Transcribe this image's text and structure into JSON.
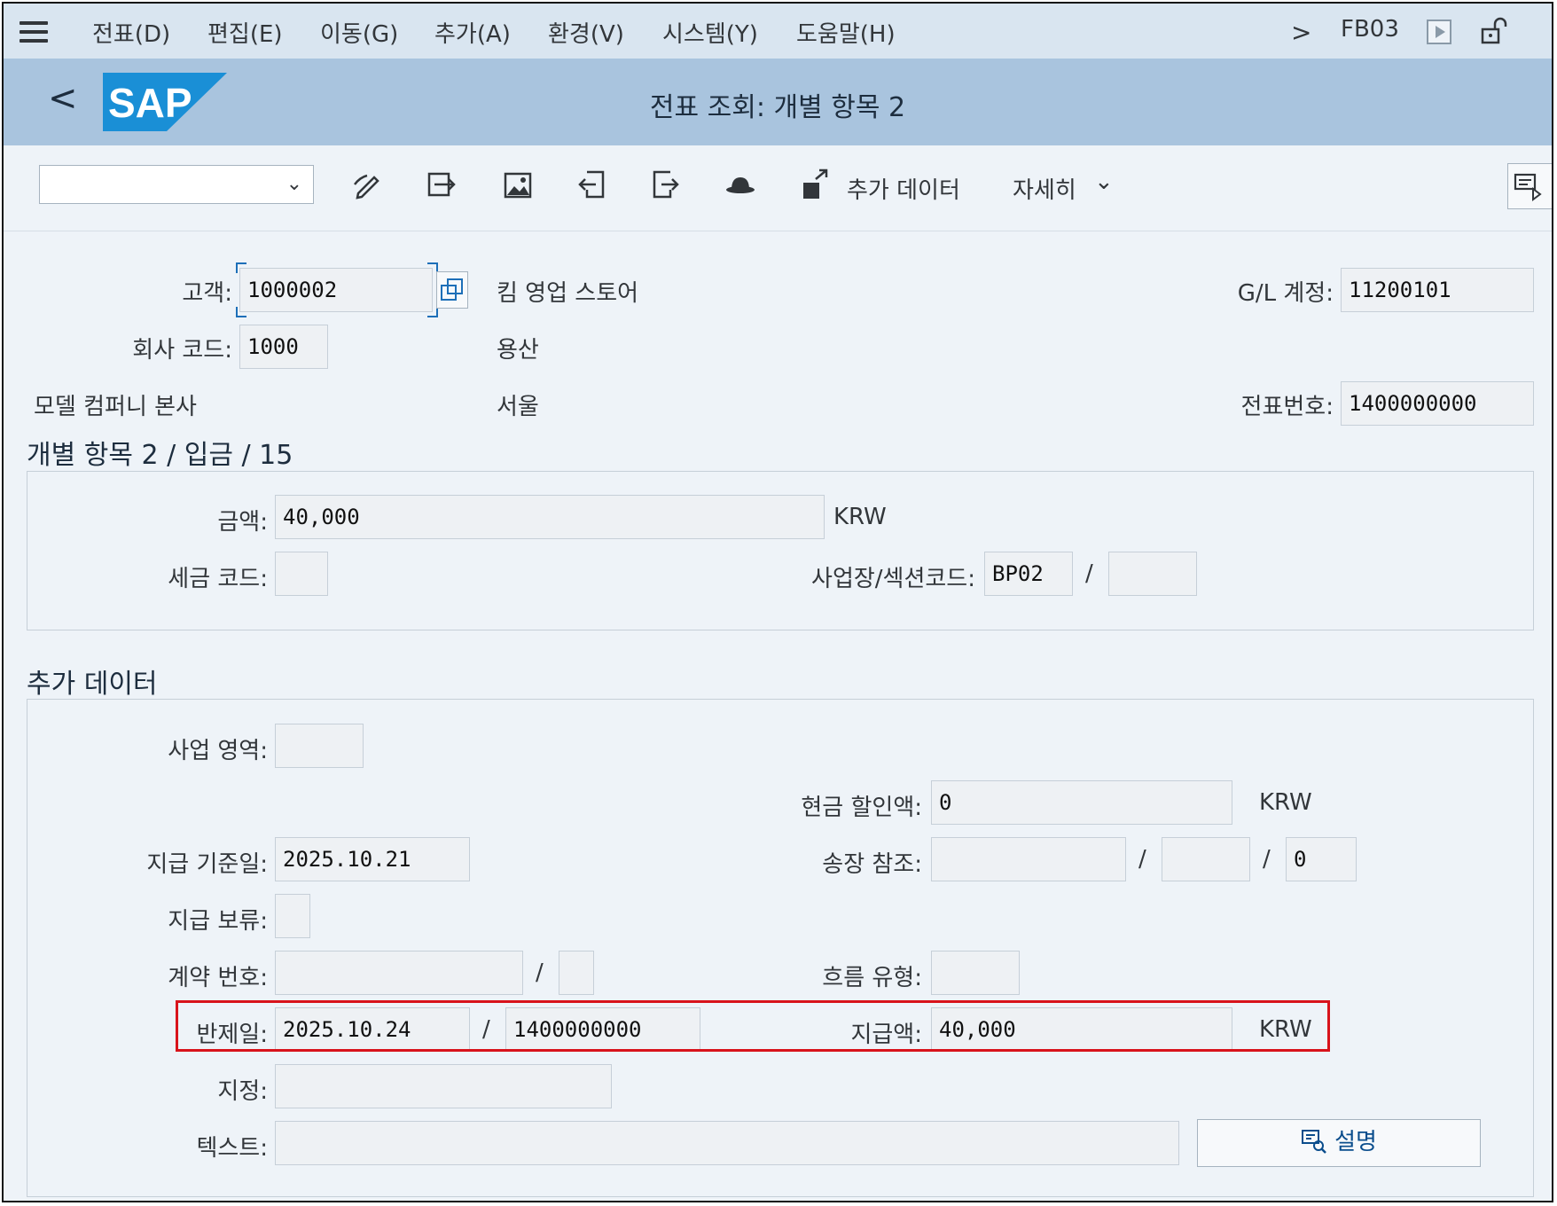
{
  "menu": {
    "items": [
      "전표(D)",
      "편집(E)",
      "이동(G)",
      "추가(A)",
      "환경(V)",
      "시스템(Y)",
      "도움말(H)"
    ],
    "tcode": "FB03"
  },
  "titlebar": {
    "logo": "SAP",
    "title": "전표 조회: 개별 항목 2"
  },
  "toolbar": {
    "select_value": "",
    "icons": [
      "edit-icon",
      "switch-icon",
      "image-icon",
      "previous-item-icon",
      "next-item-icon",
      "hat-icon",
      "additional-data-icon"
    ],
    "additional_data_label": "추가 데이터",
    "more_label": "자세히"
  },
  "header": {
    "customer_label": "고객:",
    "customer_value": "1000002",
    "customer_name": "킴 영업 스토어",
    "company_code_label": "회사 코드:",
    "company_code_value": "1000",
    "city": "용산",
    "company_name": "모델 컴퍼니 본사",
    "region": "서울",
    "gl_label": "G/L 계정:",
    "gl_value": "11200101",
    "doc_no_label": "전표번호:",
    "doc_no_value": "1400000000"
  },
  "item_section": {
    "title": "개별 항목 2 / 입금 / 15",
    "amount_label": "금액:",
    "amount_value": "40,000",
    "amount_currency": "KRW",
    "tax_code_label": "세금 코드:",
    "tax_code_value": "",
    "business_place_label": "사업장/섹션코드:",
    "business_place_value": "BP02",
    "section_code_value": "",
    "slash": "/"
  },
  "additional_section": {
    "title": "추가 데이터",
    "business_area_label": "사업 영역:",
    "business_area_value": "",
    "cash_discount_label": "현금 할인액:",
    "cash_discount_value": "0",
    "cash_discount_currency": "KRW",
    "baseline_date_label": "지급 기준일:",
    "baseline_date_value": "2025.10.21",
    "invoice_ref_label": "송장 참조:",
    "invoice_ref_1": "",
    "invoice_ref_2": "",
    "invoice_ref_3": "0",
    "payment_block_label": "지급 보류:",
    "payment_block_value": "",
    "contract_no_label": "계약 번호:",
    "contract_no_1": "",
    "contract_no_2": "",
    "flow_type_label": "흐름 유형:",
    "flow_type_value": "",
    "clearing_label": "반제일:",
    "clearing_date": "2025.10.24",
    "clearing_doc": "1400000000",
    "payment_amount_label": "지급액:",
    "payment_amount_value": "40,000",
    "payment_amount_currency": "KRW",
    "assignment_label": "지정:",
    "assignment_value": "",
    "text_label": "텍스트:",
    "text_value": "",
    "explain_button": "설명",
    "slash": "/"
  },
  "colors": {
    "highlight": "#d8131b",
    "title_bar": "#a9c4de",
    "menu_bar": "#d9e5f0",
    "sap_blue": "#1a8fd6"
  }
}
